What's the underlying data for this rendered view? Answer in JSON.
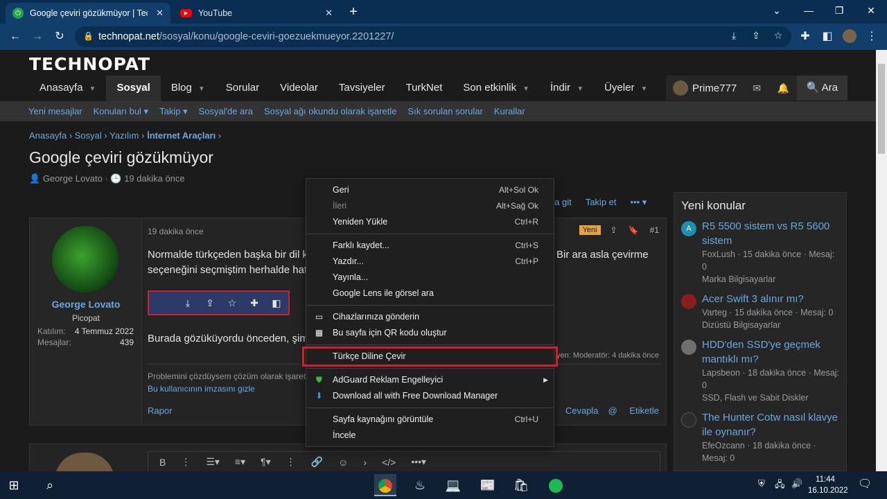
{
  "browser": {
    "tabs": [
      {
        "title": "Google çeviri gözükmüyor | Technopat",
        "active": true
      },
      {
        "title": "YouTube",
        "active": false
      }
    ],
    "url_host": "technopat.net",
    "url_path": "/sosyal/konu/google-ceviri-goezuekmueyor.2201227/"
  },
  "site": {
    "logo": "TECHNOPAT",
    "nav": [
      {
        "label": "Anasayfa",
        "caret": true,
        "active": false
      },
      {
        "label": "Sosyal",
        "caret": false,
        "active": true
      },
      {
        "label": "Blog",
        "caret": true,
        "active": false
      },
      {
        "label": "Sorular",
        "caret": false,
        "active": false
      },
      {
        "label": "Videolar",
        "caret": false,
        "active": false
      },
      {
        "label": "Tavsiyeler",
        "caret": false,
        "active": false
      },
      {
        "label": "TurkNet",
        "caret": false,
        "active": false
      },
      {
        "label": "Son etkinlik",
        "caret": true,
        "active": false
      },
      {
        "label": "İndir",
        "caret": true,
        "active": false
      },
      {
        "label": "Üyeler",
        "caret": true,
        "active": false
      }
    ],
    "username": "Prime777",
    "search_label": "Ara",
    "subnav": [
      "Yeni mesajlar",
      "Konuları bul ▾",
      "Takip ▾",
      "Sosyal'de ara",
      "Sosyal ağı okundu olarak işaretle",
      "Sık sorulan sorular",
      "Kurallar"
    ]
  },
  "thread": {
    "breadcrumb": [
      "Anasayfa",
      "Sosyal",
      "Yazılım",
      "İnternet Araçları"
    ],
    "title": "Google çeviri gözükmüyor",
    "author": "George Lovato",
    "time": "19 dakika önce",
    "actions": [
      "aja git",
      "Takip et"
    ]
  },
  "post": {
    "username": "George Lovato",
    "role": "Picopat",
    "joined_label": "Katılım:",
    "joined": "4 Temmuz 2022",
    "messages_label": "Mesajlar:",
    "messages": "439",
    "date": "19 dakika önce",
    "new_badge": "Yeni",
    "number": "#1",
    "text1": "Normalde türkçeden başka bir dil k",
    "text1b": "Bir ara asla çevirme",
    "text2": "seçeneğini seçmiştim herhalde hatı",
    "text3": "Burada gözüküyordu önceden, şim",
    "edited": "yen: Moderatör: 4 dakika önce",
    "sig1": "Problemini çözdüysem çözüm olarak işaretl",
    "sig2": "Bu kullanıcının imzasını gizle",
    "report": "Rapor",
    "reply": "Cevapla",
    "tag": "Etiketle"
  },
  "context_menu": {
    "items": [
      {
        "label": "Geri",
        "shortcut": "Alt+Sol Ok"
      },
      {
        "label": "İleri",
        "shortcut": "Alt+Sağ Ok"
      },
      {
        "label": "Yeniden Yükle",
        "shortcut": "Ctrl+R"
      },
      {
        "label": "Farklı kaydet...",
        "shortcut": "Ctrl+S"
      },
      {
        "label": "Yazdır...",
        "shortcut": "Ctrl+P"
      },
      {
        "label": "Yayınla...",
        "shortcut": ""
      },
      {
        "label": "Google Lens ile görsel ara",
        "shortcut": ""
      },
      {
        "label": "Cihazlarınıza gönderin",
        "shortcut": ""
      },
      {
        "label": "Bu sayfa için QR kodu oluştur",
        "shortcut": ""
      },
      {
        "label": "Türkçe Diline Çevir",
        "shortcut": ""
      },
      {
        "label": "AdGuard Reklam Engelleyici",
        "shortcut": ""
      },
      {
        "label": "Download all with Free Download Manager",
        "shortcut": ""
      },
      {
        "label": "Sayfa kaynağını görüntüle",
        "shortcut": "Ctrl+U"
      },
      {
        "label": "İncele",
        "shortcut": ""
      }
    ]
  },
  "sidebar": {
    "title": "Yeni konular",
    "items": [
      {
        "title": "R5 5500 sistem vs R5 5600 sistem",
        "meta": "FoxLush · 15 dakika önce · Mesaj: 0",
        "forum": "Marka Bilgisayarlar",
        "avatar": "A",
        "color": "#1e8fb0"
      },
      {
        "title": "Acer Swift 3 alınır mı?",
        "meta": "Varteg · 15 dakika önce · Mesaj: 0",
        "forum": "Dizüstü Bilgisayarlar",
        "avatar": "",
        "color": "#8b1d1d"
      },
      {
        "title": "HDD'den SSD'ye geçmek mantıklı mı?",
        "meta": "Lapsbeon · 18 dakika önce · Mesaj: 0",
        "forum": "SSD, Flash ve Sabit Diskler",
        "avatar": "",
        "color": "#6f6f6f"
      },
      {
        "title": "The Hunter Cotw nasıl klavye ile oynanır?",
        "meta": "EfeOzcann · 18 dakika önce · Mesaj: 0",
        "forum": "",
        "avatar": "",
        "color": "#2c2c2c"
      }
    ]
  },
  "taskbar": {
    "time": "11:44",
    "date": "16.10.2022"
  }
}
